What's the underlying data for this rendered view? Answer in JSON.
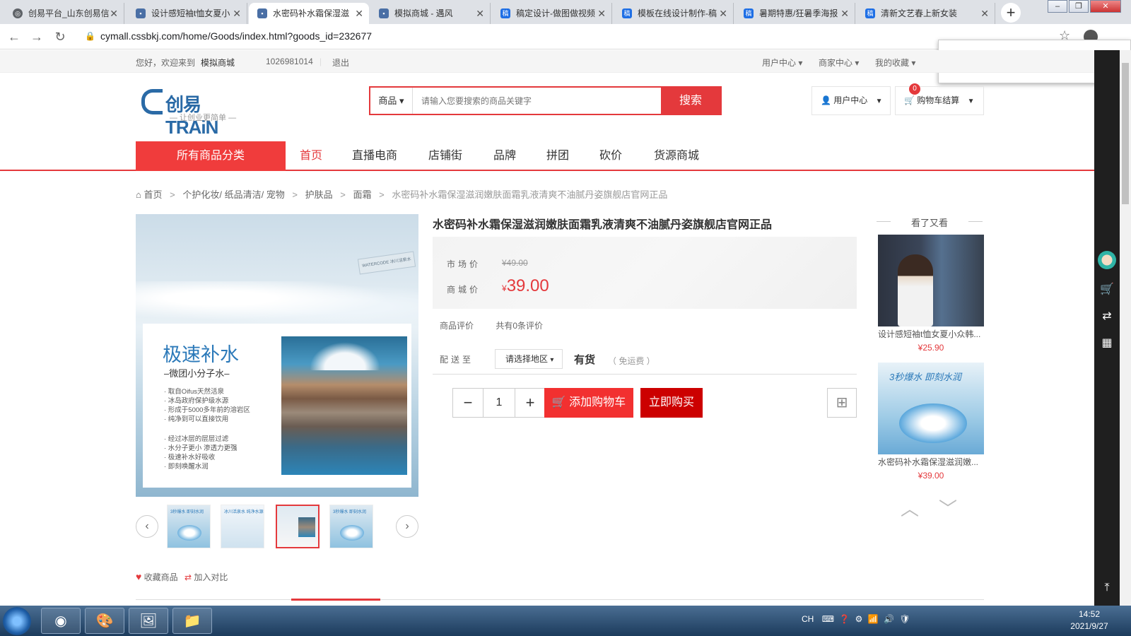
{
  "browser": {
    "tabs": [
      {
        "label": "创易平台_山东创易信",
        "fav": "globe-icon",
        "fav_color": "#5f6368",
        "active": false
      },
      {
        "label": "设计感短袖t恤女夏小",
        "fav": "site-icon",
        "fav_color": "#4a6fa5",
        "active": false
      },
      {
        "label": "水密码补水霜保湿滋",
        "fav": "site-icon",
        "fav_color": "#4a6fa5",
        "active": true
      },
      {
        "label": "模拟商城 - 遇风",
        "fav": "site-icon",
        "fav_color": "#4a6fa5",
        "active": false
      },
      {
        "label": "稿定设计-做图做视频",
        "fav": "gaoding-icon",
        "fav_color": "#1f6fe5",
        "active": false
      },
      {
        "label": "模板在线设计制作-稿",
        "fav": "gaoding-icon",
        "fav_color": "#1f6fe5",
        "active": false
      },
      {
        "label": "暑期特惠/狂暑季海报",
        "fav": "gaoding-icon",
        "fav_color": "#1f6fe5",
        "active": false
      },
      {
        "label": "清新文艺春上新女装",
        "fav": "gaoding-icon",
        "fav_color": "#1f6fe5",
        "active": false
      }
    ],
    "fav_glyph": "稿",
    "url": "cymall.cssbkj.com/home/Goods/index.html?goods_id=232677"
  },
  "site_top": {
    "greeting": "您好，欢迎来到",
    "mall_name": "模拟商城",
    "user_id": "1026981014",
    "logout": "退出",
    "links": [
      "用户中心",
      "商家中心",
      "我的收藏"
    ]
  },
  "header": {
    "logo_brand": "创易TRAiN",
    "logo_slogan": "— 让创业更简单 —",
    "search_category": "商品",
    "search_placeholder": "请输入您要搜索的商品关键字",
    "search_button": "搜索",
    "user_center": "用户中心",
    "cart_label": "购物车结算",
    "cart_count": "0"
  },
  "nav": {
    "all_categories": "所有商品分类",
    "items": [
      "首页",
      "直播电商",
      "店铺街",
      "品牌",
      "拼团",
      "砍价",
      "货源商城"
    ]
  },
  "breadcrumb": [
    "首页",
    "个护化妆/ 纸品清洁/ 宠物",
    "护肤品",
    "面霜",
    "水密码补水霜保湿滋润嫩肤面霜乳液清爽不油腻丹姿旗舰店官网正品"
  ],
  "product": {
    "title": "水密码补水霜保湿滋润嫩肤面霜乳液清爽不油腻丹姿旗舰店官网正品",
    "market_price_label": "市场价",
    "market_price": "¥49.00",
    "shop_price_label": "商城价",
    "currency": "¥",
    "shop_price": "39.00",
    "rating_label": "商品评价",
    "rating_text": "共有0条评价",
    "delivery_label": "配送至",
    "region_placeholder": "请选择地区",
    "stock": "有货",
    "shipping": "（ 免运费 ）",
    "quantity": "1",
    "add_to_cart": "添加购物车",
    "buy_now": "立即购买",
    "favorite": "收藏商品",
    "compare": "加入对比",
    "image": {
      "heading": "极速补水",
      "sub": "–微团小分子水–",
      "sign_text": "WATERCODE 冰川活泉水",
      "bullets": [
        "· 取自Oifus天然活泉",
        "· 冰岛政府保护级水源",
        "· 形成于5000多年前的溶岩区",
        "· 纯净到可以直接饮用",
        "· 经过冰层的层层过滤",
        "· 水分子更小 渗透力更强",
        "· 极速补水好吸收",
        "· 即刻唤醒水润"
      ]
    },
    "thumbs": [
      {
        "caption": "3秒爆水 即刻水润"
      },
      {
        "caption": "冰川活泉水 纯净水源"
      },
      {
        "caption": ""
      },
      {
        "caption": "3秒爆水 即刻水润"
      }
    ]
  },
  "also_viewed": {
    "title": "看了又看",
    "items": [
      {
        "name": "设计感短袖t恤女夏小众韩...",
        "price": "¥25.90"
      },
      {
        "name": "水密码补水霜保湿滋润嫩...",
        "price": "¥39.00",
        "img_caption": "3秒爆水 即刻水润"
      }
    ]
  },
  "taskbar": {
    "tray_lang": "CH",
    "time": "14:52",
    "date": "2021/9/27"
  },
  "colors": {
    "accent": "#e4393c",
    "brand": "#2a6aa6"
  }
}
